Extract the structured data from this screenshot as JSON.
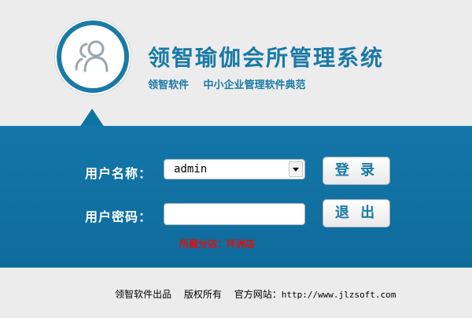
{
  "header": {
    "title": "领智瑜伽会所管理系统",
    "subtitle_brand": "领智软件",
    "subtitle_slogan": "中小企业管理软件典范",
    "logo_icon": "users-icon"
  },
  "login": {
    "username_label": "用户名称：",
    "username_value": "admin",
    "password_label": "用户密码：",
    "password_value": "",
    "login_button": "登 录",
    "exit_button": "退 出",
    "branch_label": "所属分店：",
    "branch_value": "环洲店"
  },
  "footer": {
    "company": "领智软件出品",
    "copyright": "版权所有",
    "website_label": "官方网站：",
    "website_url": "http://www.jlzsoft.com"
  },
  "colors": {
    "accent": "#1a7aa6",
    "band": "#0f73a3",
    "warning": "#e01010",
    "background": "#ececec"
  }
}
